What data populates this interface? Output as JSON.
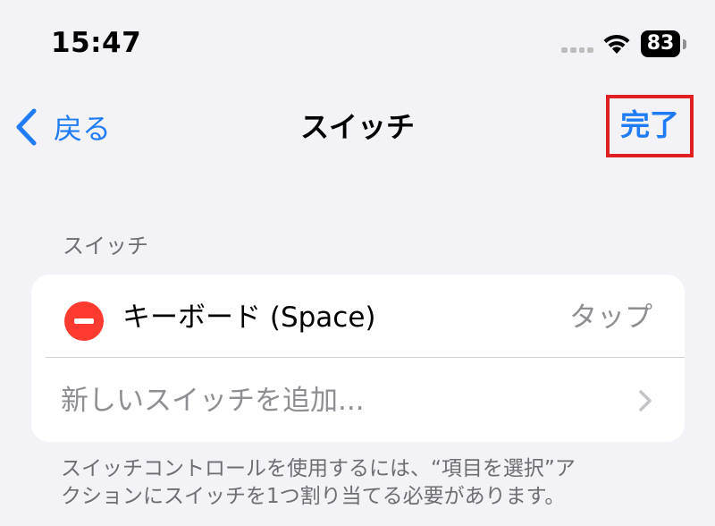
{
  "status_bar": {
    "time": "15:47",
    "battery_level": "83",
    "icons": [
      "cellular-signal-icon",
      "wifi-icon",
      "battery-icon"
    ]
  },
  "nav": {
    "back_label": "戻る",
    "title": "スイッチ",
    "done_label": "完了"
  },
  "section": {
    "header": "スイッチ",
    "switch_item": {
      "name": "キーボード (Space)",
      "action": "タップ"
    },
    "add_item_label": "新しいスイッチを追加..."
  },
  "footer": {
    "line1": "スイッチコントロールを使用するには、“項目を選択”ア",
    "line2": "クションにスイッチを1つ割り当てる必要があります。"
  },
  "colors": {
    "accent": "#1f7cf5",
    "destructive": "#ff3b30",
    "highlight_border": "#e02020",
    "background": "#f2f2f7",
    "secondary_text": "#8e8e93"
  }
}
